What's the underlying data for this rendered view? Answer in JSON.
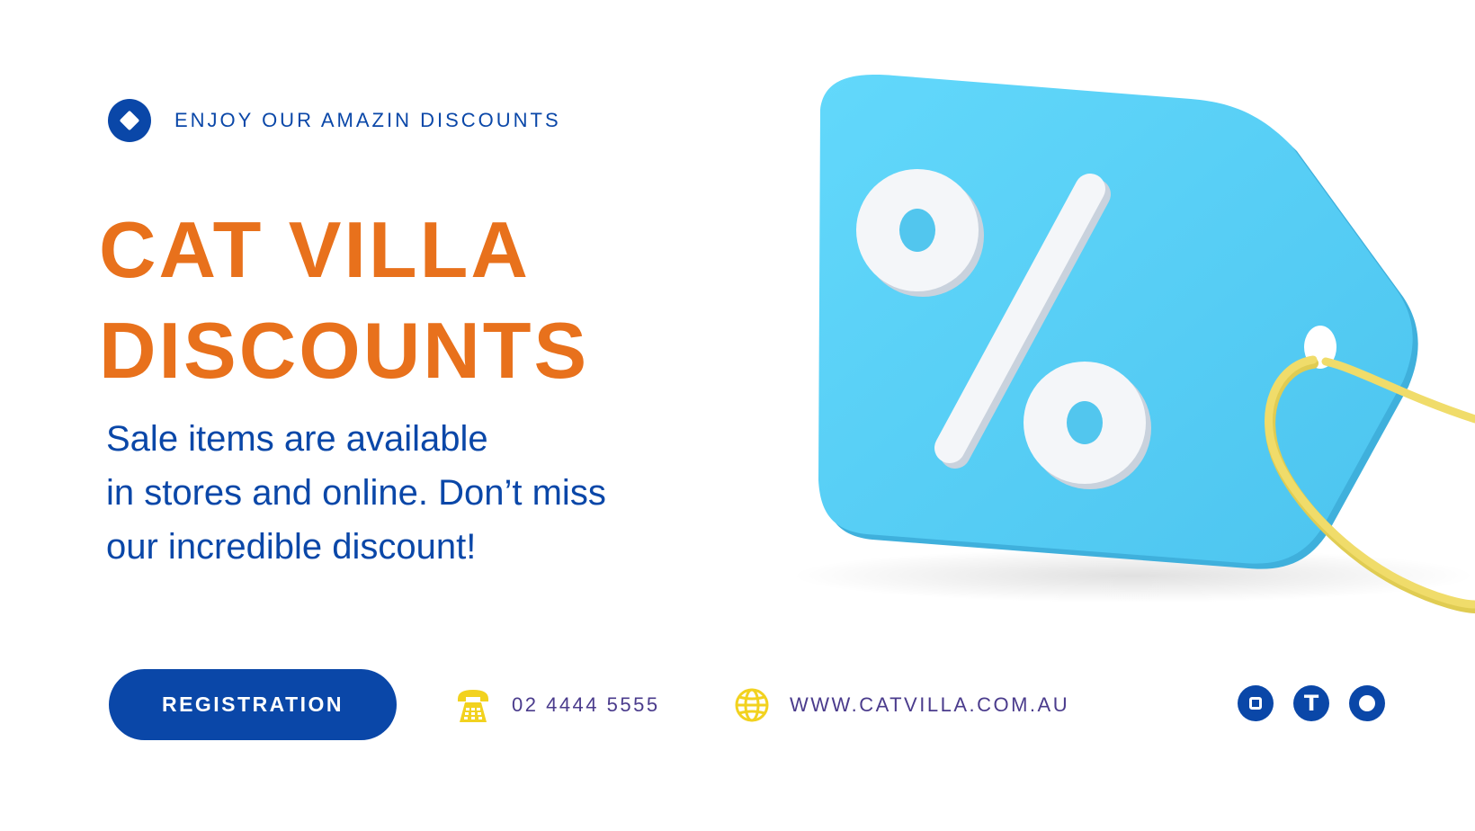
{
  "eyebrow": {
    "text": "ENJOY OUR AMAZIN DISCOUNTS",
    "icon": "diamond-icon"
  },
  "headline": {
    "line1": "CAT VILLA",
    "line2": "DISCOUNTS"
  },
  "description": {
    "line1": "Sale items are available",
    "line2": "in stores and online. Don’t miss",
    "line3": "our incredible discount!"
  },
  "cta": {
    "label": "REGISTRATION"
  },
  "contact": {
    "phone": {
      "icon": "telephone-icon",
      "text": "02 4444 5555"
    },
    "website": {
      "icon": "globe-icon",
      "text": "WWW.CATVILLA.COM.AU"
    }
  },
  "socials": [
    {
      "icon": "instagram-icon"
    },
    {
      "icon": "t-letter-icon",
      "glyph": "T"
    },
    {
      "icon": "circle-icon"
    }
  ],
  "hero_image": {
    "icon": "percent-price-tag-icon",
    "glyph": "%"
  },
  "colors": {
    "brand_blue": "#0a47a8",
    "accent_orange": "#e8711c",
    "contact_purple": "#4a3b8c",
    "tag_blue": "#5ccff5",
    "icon_yellow": "#f2d21f",
    "string_yellow": "#f0dc6a"
  }
}
